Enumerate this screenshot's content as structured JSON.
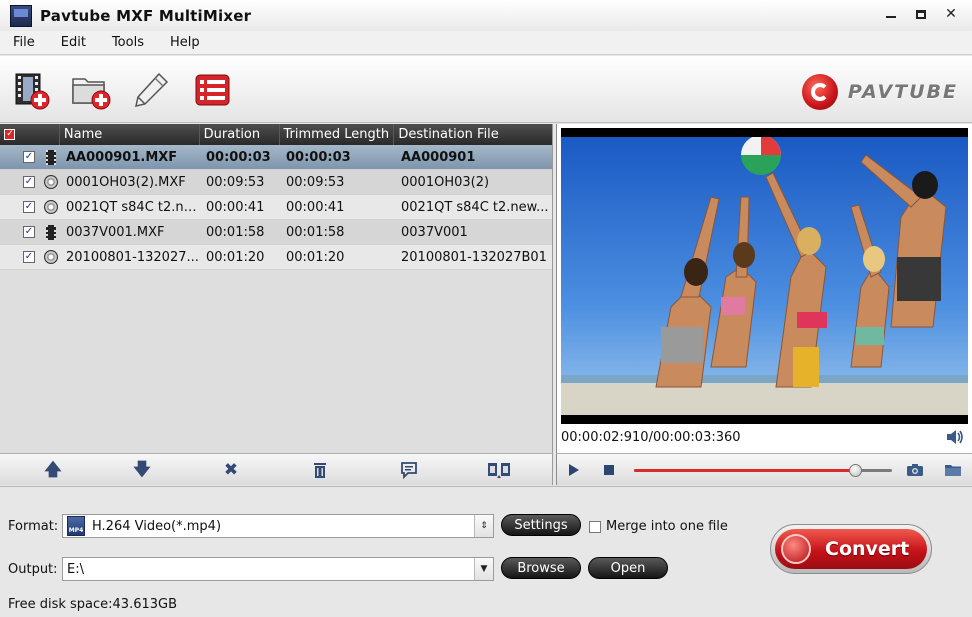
{
  "window": {
    "title": "Pavtube MXF MultiMixer"
  },
  "menu": [
    "File",
    "Edit",
    "Tools",
    "Help"
  ],
  "toolbar": {
    "buttons": [
      "add-video",
      "add-folder",
      "edit",
      "merge-list"
    ]
  },
  "logo": {
    "text": "PAVTUBE"
  },
  "file_list": {
    "columns": [
      "Name",
      "Duration",
      "Trimmed Length",
      "Destination File"
    ],
    "rows": [
      {
        "name": "AA000901.MXF",
        "duration": "00:00:03",
        "trimmed": "00:00:03",
        "dest": "AA000901",
        "icon": "film",
        "selected": true
      },
      {
        "name": "0001OH03(2).MXF",
        "duration": "00:09:53",
        "trimmed": "00:09:53",
        "dest": "0001OH03(2)",
        "icon": "disc",
        "selected": false
      },
      {
        "name": "0021QT s84C t2.ne...",
        "duration": "00:00:41",
        "trimmed": "00:00:41",
        "dest": "0021QT s84C t2.new...",
        "icon": "disc",
        "selected": false
      },
      {
        "name": "0037V001.MXF",
        "duration": "00:01:58",
        "trimmed": "00:01:58",
        "dest": "0037V001",
        "icon": "film",
        "selected": false
      },
      {
        "name": "20100801-132027...",
        "duration": "00:01:20",
        "trimmed": "00:01:20",
        "dest": "20100801-132027B01",
        "icon": "disc",
        "selected": false
      }
    ]
  },
  "preview": {
    "timecode": "00:00:02:910/00:00:03:360",
    "progress": 0.855
  },
  "output": {
    "format_label": "Format:",
    "format_value": "H.264 Video(*.mp4)",
    "format_icon_text": "MP4",
    "settings_label": "Settings",
    "merge_label": "Merge into one file",
    "output_label": "Output:",
    "output_value": "E:\\",
    "browse_label": "Browse",
    "open_label": "Open",
    "free_space": "Free disk space:43.613GB",
    "convert_label": "Convert"
  },
  "colors": {
    "accent_red": "#d82a2a",
    "selection": "#8aa0b6",
    "header_dark": "#2a2a2a"
  }
}
